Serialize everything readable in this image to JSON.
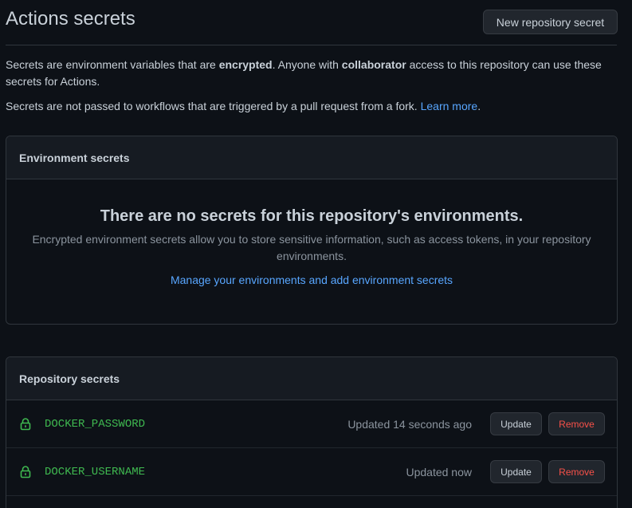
{
  "header": {
    "title": "Actions secrets",
    "new_secret_label": "New repository secret"
  },
  "intro": {
    "p1_part1": "Secrets are environment variables that are ",
    "p1_bold1": "encrypted",
    "p1_part2": ". Anyone with ",
    "p1_bold2": "collaborator",
    "p1_part3": " access to this repository can use these secrets for Actions.",
    "p2_text": "Secrets are not passed to workflows that are triggered by a pull request from a fork. ",
    "p2_link": "Learn more",
    "p2_end": "."
  },
  "environment_secrets": {
    "heading": "Environment secrets",
    "blank_title": "There are no secrets for this repository's environments.",
    "blank_desc": "Encrypted environment secrets allow you to store sensitive information, such as access tokens, in your repository environments.",
    "manage_link": "Manage your environments and add environment secrets"
  },
  "repository_secrets": {
    "heading": "Repository secrets",
    "update_label": "Update",
    "remove_label": "Remove",
    "items": [
      {
        "name": "DOCKER_PASSWORD",
        "updated": "Updated 14 seconds ago"
      },
      {
        "name": "DOCKER_USERNAME",
        "updated": "Updated now"
      }
    ]
  },
  "colors": {
    "background": "#0d1117",
    "link": "#58a6ff",
    "secret_name": "#3fb950",
    "remove": "#f85149"
  },
  "icons": {
    "secret_icon": "lock-icon"
  }
}
